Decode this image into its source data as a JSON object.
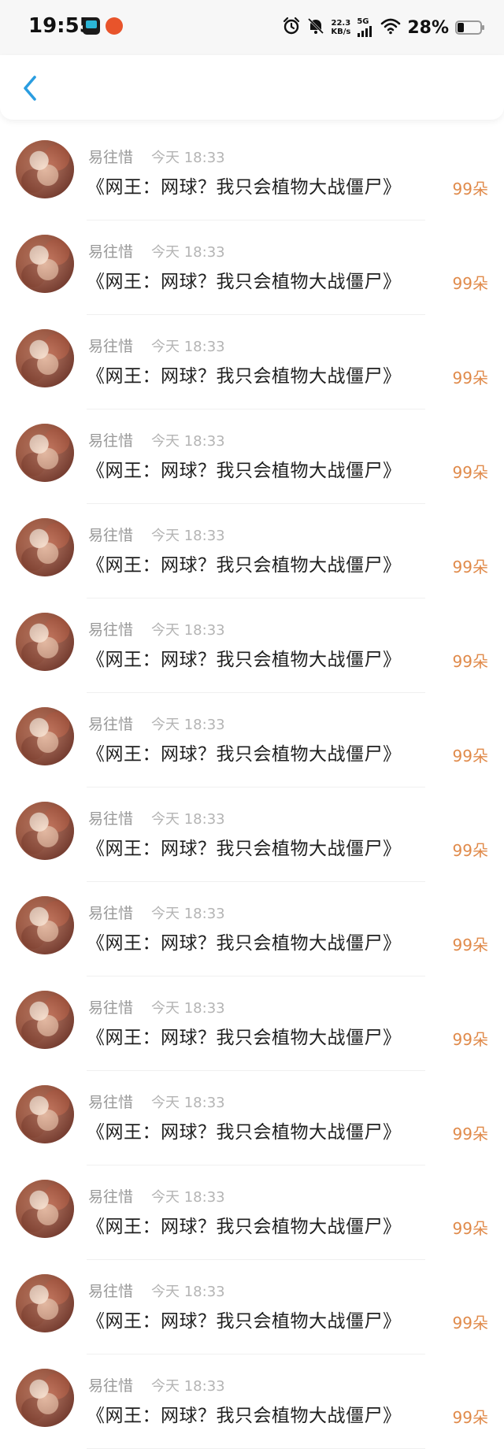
{
  "status_bar": {
    "time": "19:55",
    "net_speed": "22.3",
    "net_unit": "KB/s",
    "network": "5G",
    "battery": "28%"
  },
  "header": {
    "back_icon": "chevron-left-icon"
  },
  "colors": {
    "accent": "#2a9de0",
    "count": "#e08a4a",
    "name": "#999999",
    "time": "#b4b4b4"
  },
  "list": {
    "items": [
      {
        "name": "易往惜",
        "time": "今天 18:33",
        "title": "《网王：网球？我只会植物大战僵尸》",
        "count": "99朵"
      },
      {
        "name": "易往惜",
        "time": "今天 18:33",
        "title": "《网王：网球？我只会植物大战僵尸》",
        "count": "99朵"
      },
      {
        "name": "易往惜",
        "time": "今天 18:33",
        "title": "《网王：网球？我只会植物大战僵尸》",
        "count": "99朵"
      },
      {
        "name": "易往惜",
        "time": "今天 18:33",
        "title": "《网王：网球？我只会植物大战僵尸》",
        "count": "99朵"
      },
      {
        "name": "易往惜",
        "time": "今天 18:33",
        "title": "《网王：网球？我只会植物大战僵尸》",
        "count": "99朵"
      },
      {
        "name": "易往惜",
        "time": "今天 18:33",
        "title": "《网王：网球？我只会植物大战僵尸》",
        "count": "99朵"
      },
      {
        "name": "易往惜",
        "time": "今天 18:33",
        "title": "《网王：网球？我只会植物大战僵尸》",
        "count": "99朵"
      },
      {
        "name": "易往惜",
        "time": "今天 18:33",
        "title": "《网王：网球？我只会植物大战僵尸》",
        "count": "99朵"
      },
      {
        "name": "易往惜",
        "time": "今天 18:33",
        "title": "《网王：网球？我只会植物大战僵尸》",
        "count": "99朵"
      },
      {
        "name": "易往惜",
        "time": "今天 18:33",
        "title": "《网王：网球？我只会植物大战僵尸》",
        "count": "99朵"
      },
      {
        "name": "易往惜",
        "time": "今天 18:33",
        "title": "《网王：网球？我只会植物大战僵尸》",
        "count": "99朵"
      },
      {
        "name": "易往惜",
        "time": "今天 18:33",
        "title": "《网王：网球？我只会植物大战僵尸》",
        "count": "99朵"
      },
      {
        "name": "易往惜",
        "time": "今天 18:33",
        "title": "《网王：网球？我只会植物大战僵尸》",
        "count": "99朵"
      },
      {
        "name": "易往惜",
        "time": "今天 18:33",
        "title": "《网王：网球？我只会植物大战僵尸》",
        "count": "99朵"
      }
    ]
  }
}
